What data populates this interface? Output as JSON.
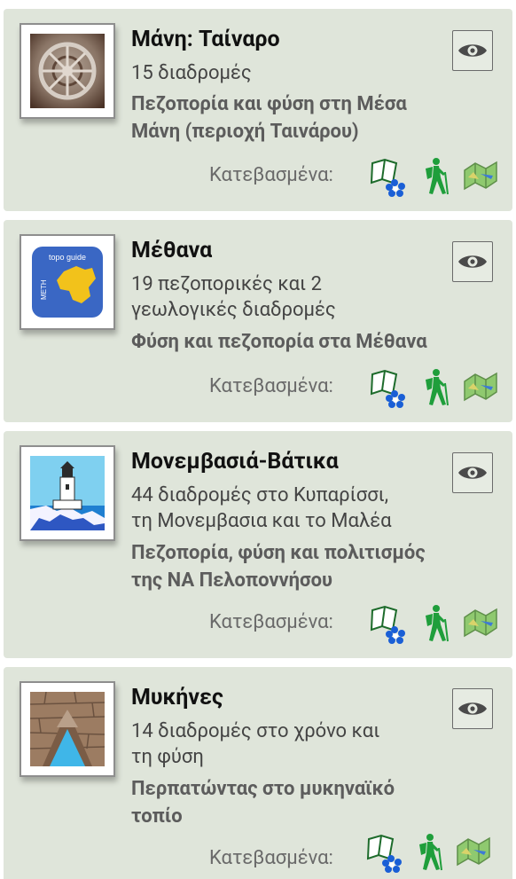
{
  "labels": {
    "downloaded": "Κατεβασμένα:"
  },
  "guides": [
    {
      "title": "Μάνη: Ταίναρο",
      "count_line1": "15 διαδρομές",
      "count_line2": "",
      "desc_line1": "Πεζοπορία και φύση στη Μέσα",
      "desc_line2": "Μάνη (περιοχή Ταινάρου)",
      "image": "stone-relief-carving"
    },
    {
      "title": "Μέθανα",
      "count_line1": "19 πεζοπορικές και 2",
      "count_line2": "γεωλογικές διαδρομές",
      "desc_line1": "Φύση και πεζοπορία στα Μέθανα",
      "desc_line2": "",
      "image": "topoguide-meth-logo",
      "logo_top": "topo guide",
      "logo_side": "METH"
    },
    {
      "title": "Μονεμβασιά-Βάτικα",
      "count_line1": "44 διαδρομές στο Κυπαρίσσι,",
      "count_line2": "τη Μονεμβασια και το Μαλέα",
      "desc_line1": "Πεζοπορία, φύση και πολιτισμός",
      "desc_line2": "της ΝΑ Πελοποννήσου",
      "image": "lighthouse"
    },
    {
      "title": "Μυκήνες",
      "count_line1": "14 διαδρομές στο χρόνο και",
      "count_line2": "τη φύση",
      "desc_line1": "Περπατώντας στο μυκηναϊκό",
      "desc_line2": "τοπίο",
      "image": "lion-gate"
    }
  ],
  "icons": [
    "eye-icon",
    "book-flower-icon",
    "hiker-icon",
    "map-icon"
  ],
  "colors": {
    "card_bg": "#dfe5da",
    "hiker_green": "#1f9e3b",
    "flower_blue": "#1a5fd6",
    "logo_blue": "#3a67c4",
    "logo_yellow": "#f2c21b"
  }
}
